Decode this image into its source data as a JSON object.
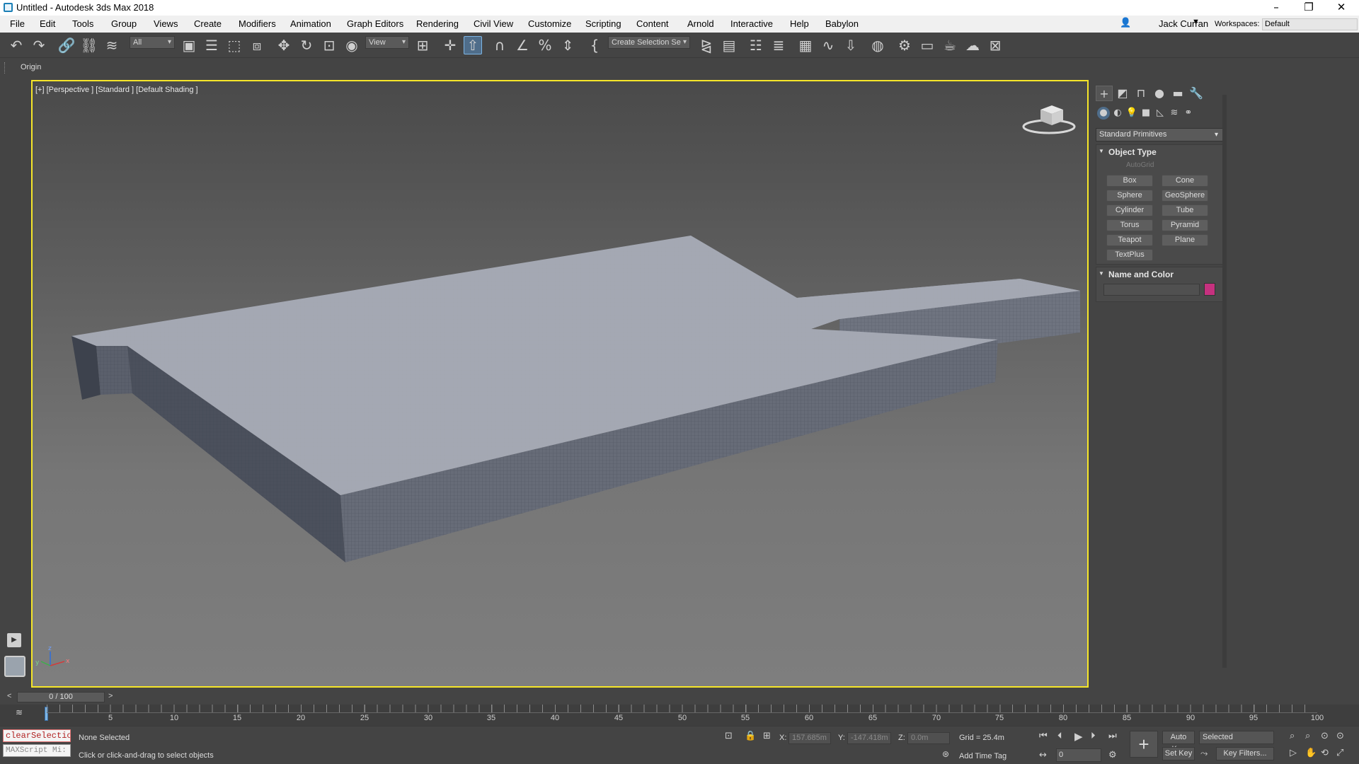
{
  "window": {
    "title": "Untitled - Autodesk 3ds Max 2018"
  },
  "menu": [
    "File",
    "Edit",
    "Tools",
    "Group",
    "Views",
    "Create",
    "Modifiers",
    "Animation",
    "Graph Editors",
    "Rendering",
    "Civil View",
    "Customize",
    "Scripting",
    "Content",
    "Arnold",
    "Interactive",
    "Help",
    "Babylon"
  ],
  "user": {
    "name": "Jack Curran"
  },
  "workspaces": {
    "label": "Workspaces:",
    "value": "Default"
  },
  "toolbar": {
    "filter": "All",
    "ref_coord": "View",
    "selection_set": "Create Selection Se"
  },
  "ribbon": {
    "origin_label": "Origin"
  },
  "viewport": {
    "label": "[+] [Perspective ] [Standard ] [Default Shading ]"
  },
  "command_panel": {
    "primitives_dropdown": "Standard Primitives",
    "object_type": {
      "title": "Object Type",
      "autogrid": "AutoGrid",
      "buttons": [
        "Box",
        "Cone",
        "Sphere",
        "GeoSphere",
        "Cylinder",
        "Tube",
        "Torus",
        "Pyramid",
        "Teapot",
        "Plane",
        "TextPlus"
      ]
    },
    "name_and_color": {
      "title": "Name and Color",
      "color": "#c6317f"
    }
  },
  "timeline": {
    "frame": "0 / 100",
    "ticks": [
      "5",
      "10",
      "15",
      "20",
      "25",
      "30",
      "35",
      "40",
      "45",
      "50",
      "55",
      "60",
      "65",
      "70",
      "75",
      "80",
      "85",
      "90",
      "95",
      "100"
    ]
  },
  "status": {
    "script_line1": "clearSelectio",
    "script_line2": "MAXScript Mi:",
    "selection": "None Selected",
    "prompt": "Click or click-and-drag to select objects",
    "x_label": "X:",
    "x": "157.685m",
    "y_label": "Y:",
    "y": "-147.418m",
    "z_label": "Z:",
    "z": "0.0m",
    "grid": "Grid = 25.4m",
    "add_time_tag": "Add Time Tag",
    "auto_key": "Auto Key",
    "set_key": "Set Key",
    "selected": "Selected",
    "key_filters": "Key Filters...",
    "frame_field": "0"
  },
  "colors": {
    "viewport_border": "#f6e629",
    "accent": "#4f6d8a"
  }
}
